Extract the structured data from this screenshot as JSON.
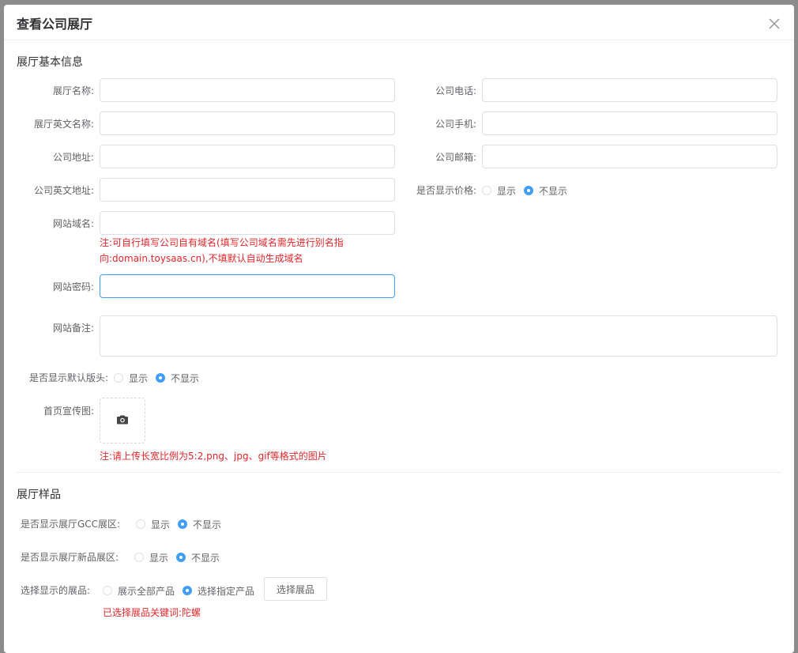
{
  "dialog": {
    "title": "查看公司展厅",
    "close_icon": "close-icon"
  },
  "basic_section": {
    "title": "展厅基本信息",
    "fields": {
      "hall_name_label": "展厅名称:",
      "hall_name_value": "",
      "company_phone_label": "公司电话:",
      "company_phone_value": "",
      "hall_en_name_label": "展厅英文名称:",
      "hall_en_name_value": "",
      "company_mobile_label": "公司手机:",
      "company_mobile_value": "",
      "company_address_label": "公司地址:",
      "company_address_value": "",
      "company_email_label": "公司邮箱:",
      "company_email_value": "",
      "company_en_address_label": "公司英文地址:",
      "company_en_address_value": "",
      "show_price_label": "是否显示价格:",
      "show_price_options": [
        "显示",
        "不显示"
      ],
      "show_price_selected": "不显示",
      "domain_label": "网站域名:",
      "domain_value": "",
      "domain_note_line1": "注:可自行填写公司自有域名(填写公司域名需先进行别名指",
      "domain_note_line2": "向:domain.toysaas.cn),不填默认自动生成域名",
      "password_label": "网站密码:",
      "password_value": "",
      "remark_label": "网站备注:",
      "remark_value": "",
      "show_header_label": "是否显示默认版头:",
      "show_header_options": [
        "显示",
        "不显示"
      ],
      "show_header_selected": "不显示",
      "banner_label": "首页宣传图:",
      "banner_icon": "camera-icon",
      "banner_note": "注:请上传长宽比例为5:2,png、jpg、gif等格式的图片"
    }
  },
  "sample_section": {
    "title": "展厅样品",
    "show_gcc_label": "是否显示展厅GCC展区:",
    "show_gcc_options": [
      "显示",
      "不显示"
    ],
    "show_gcc_selected": "不显示",
    "show_new_label": "是否显示展厅新品展区:",
    "show_new_options": [
      "显示",
      "不显示"
    ],
    "show_new_selected": "不显示",
    "select_products_label": "选择显示的展品:",
    "select_products_options": [
      "展示全部产品",
      "选择指定产品"
    ],
    "select_products_selected": "选择指定产品",
    "select_button_label": "选择展品",
    "selected_keyword_note": "已选择展品关键词:陀螺"
  },
  "colors": {
    "accent": "#409eff",
    "note_red": "#e4272a",
    "border": "#dcdfe6",
    "overlay": "#8c8c8c"
  }
}
